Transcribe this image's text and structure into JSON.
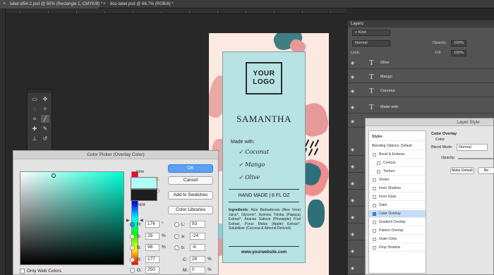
{
  "tabs": [
    {
      "label": "label id54-2.psd @ 50% (Rectangle 1, CMYK/8) *"
    },
    {
      "label": "8oz-label.psd @ 66.7% (RGB/8) *"
    }
  ],
  "label": {
    "logo_line1": "YOUR",
    "logo_line2": "LOGO",
    "name": "SAMANTHA",
    "made_with": "Made with:",
    "flavors": [
      "✓ Coconut",
      "✓ Mango",
      "✓ Olive"
    ],
    "size_line": "HAND MADE  |  8 FL OZ",
    "ingredients_head": "Ingredients:",
    "ingredients_body": " Aloe Barbadensis (Aloe Vera) Juice*, Glycerin*, Asimina Triloba (Papaya) Extract*, Ananas Sativus (Pineapple) Fruit Extract, Pyrus Malus (Apple) Extract*, Solubilizer (Coconut & Almond Derived).",
    "website": "www.yourwebsite.com"
  },
  "color_picker": {
    "title": "Color Picker (Overlay Color)",
    "new_label": "new",
    "current_label": "current",
    "ok": "OK",
    "cancel": "Cancel",
    "add_swatches": "Add to Swatches",
    "color_libraries": "Color Libraries",
    "only_web_colors": "Only Web Colors",
    "new_color": "#affff6",
    "current_color": "#1e1e1e",
    "fields": {
      "h_label": "H:",
      "h_value": "176",
      "h_unit": "°",
      "s_label": "S:",
      "s_value": "29",
      "s_unit": "%",
      "b_label": "B:",
      "b_value": "98",
      "b_unit": "%",
      "r_label": "R:",
      "r_value": "177",
      "g_label": "G:",
      "g_value": "250",
      "l_label": "L:",
      "l_value": "93",
      "a_label": "a:",
      "a_value": "-24",
      "b2_label": "b:",
      "b2_value": "-6",
      "c_label": "C:",
      "c_value": "26",
      "c_unit": "%",
      "m_label": "M:",
      "m_value": "0",
      "m_unit": "%"
    }
  },
  "layers_panel": {
    "title": "Layers",
    "kind": "Kind",
    "blend": "Normal",
    "opacity_label": "Opacity:",
    "opacity_value": "100%",
    "lock_label": "Lock:",
    "fill_label": "Fill:",
    "fill_value": "100%",
    "items": [
      "Olive",
      "Mango",
      "Coconut",
      "Made with:"
    ]
  },
  "layer_style": {
    "title": "Layer Style",
    "styles_header": "Styles",
    "blending_options": "Blending Options: Default",
    "items": [
      "Bevel & Emboss",
      "Contour",
      "Texture",
      "Stroke",
      "Inner Shadow",
      "Inner Glow",
      "Satin",
      "Color Overlay",
      "Gradient Overlay",
      "Pattern Overlay",
      "Outer Glow",
      "Drop Shadow"
    ],
    "selected": "Color Overlay",
    "section_title": "Color Overlay",
    "subsection": "Color",
    "blend_mode_label": "Blend Mode:",
    "blend_mode_value": "Normal",
    "opacity_label": "Opacity:",
    "make_default": "Make Default",
    "reset": "Re"
  }
}
